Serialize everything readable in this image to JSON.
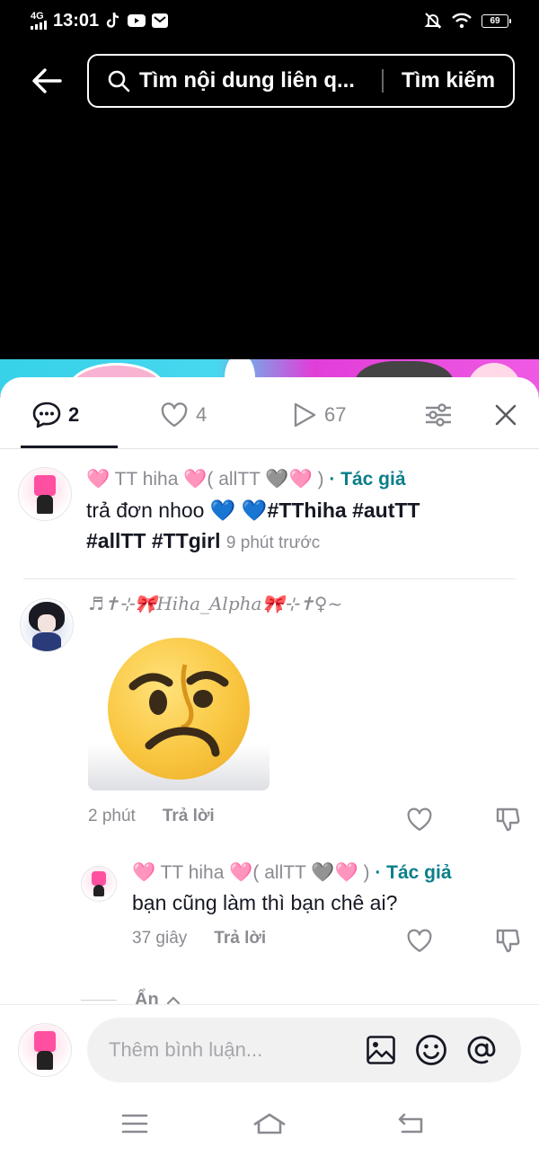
{
  "status_bar": {
    "network": "4G",
    "time": "13:01",
    "battery": "69",
    "icons": [
      "signal-icon",
      "tiktok-icon",
      "youtube-icon",
      "mail-icon",
      "mute-icon",
      "wifi-icon",
      "battery-icon"
    ]
  },
  "search": {
    "query": "Tìm nội dung liên q...",
    "button": "Tìm kiếm"
  },
  "tabs": {
    "comments_count": "2",
    "likes_count": "4",
    "plays_count": "67"
  },
  "comments": [
    {
      "user_prefix": "🩷 TT hiha 🩷( allTT 🩶🩷 )",
      "author_tag": "· Tác giả",
      "text_plain": "trả đơn nhoo 💙 💙",
      "hashtags_line1": "#TThiha #autTT",
      "hashtags_line2": "#allTT #TTgirl",
      "time": "9 phút trước"
    },
    {
      "user": "♬✝⊹🎀𝐻𝑖ℎ𝑎_𝐴𝑙𝑝ℎ𝑎🎀⊹✝♀~",
      "time": "2 phút",
      "reply_label": "Trả lời",
      "sticker": "worried-face-sticker",
      "reply": {
        "user_prefix": "🩷 TT hiha 🩷( allTT 🩶🩷 )",
        "author_tag": "· Tác giả",
        "text": "bạn cũng làm thì bạn chê ai?",
        "time": "37 giây",
        "reply_label": "Trả lời"
      }
    }
  ],
  "hide_label": "Ẩn",
  "input": {
    "placeholder": "Thêm bình luận..."
  },
  "colors": {
    "author": "#0b7f8a",
    "text": "#161823",
    "muted": "#8a8b91"
  }
}
